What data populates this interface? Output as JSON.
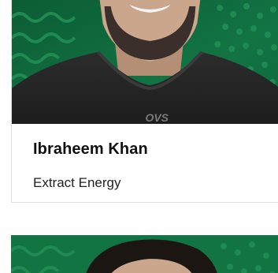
{
  "speakers": [
    {
      "name": "Ibraheem Khan",
      "company": "Extract Energy",
      "photo_icon": "speaker-portrait",
      "shirt_text": "OVS"
    },
    {
      "name": "",
      "company": "",
      "photo_icon": "speaker-portrait"
    }
  ],
  "colors": {
    "photo_bg": "#0f6b3e",
    "photo_pattern": "#1f8a52",
    "shirt": "#2a2a2a",
    "skin": "#c9a68c",
    "beard": "#3a2f2a",
    "card_border": "#e2e2e2",
    "name_text": "#111111",
    "company_text": "#222222"
  }
}
